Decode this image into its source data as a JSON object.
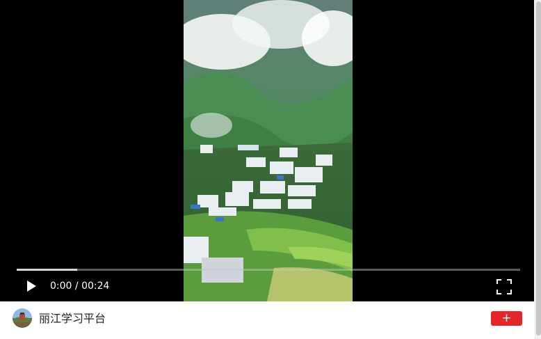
{
  "player": {
    "current_time": "0:00",
    "separator": " / ",
    "duration": "00:24",
    "buffered_fraction": 0.12
  },
  "icons": {
    "play": "play-icon",
    "fullscreen": "fullscreen-icon",
    "follow": "plus-icon"
  },
  "footer": {
    "channel_name": "丽江学习平台",
    "follow_label": "+"
  },
  "colors": {
    "accent": "#e6252a",
    "player_bg": "#000000"
  }
}
